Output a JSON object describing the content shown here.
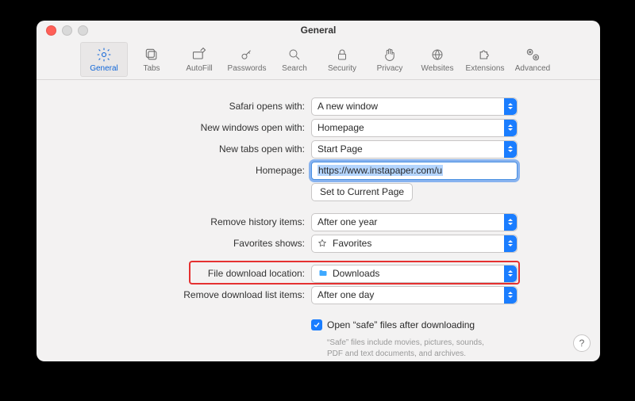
{
  "window": {
    "title": "General"
  },
  "tabs": [
    {
      "id": "general",
      "label": "General",
      "active": true
    },
    {
      "id": "tabs",
      "label": "Tabs",
      "active": false
    },
    {
      "id": "autofill",
      "label": "AutoFill",
      "active": false
    },
    {
      "id": "passwords",
      "label": "Passwords",
      "active": false
    },
    {
      "id": "search",
      "label": "Search",
      "active": false
    },
    {
      "id": "security",
      "label": "Security",
      "active": false
    },
    {
      "id": "privacy",
      "label": "Privacy",
      "active": false
    },
    {
      "id": "websites",
      "label": "Websites",
      "active": false
    },
    {
      "id": "extensions",
      "label": "Extensions",
      "active": false
    },
    {
      "id": "advanced",
      "label": "Advanced",
      "active": false
    }
  ],
  "form": {
    "opens_with": {
      "label": "Safari opens with:",
      "value": "A new window"
    },
    "new_windows": {
      "label": "New windows open with:",
      "value": "Homepage"
    },
    "new_tabs": {
      "label": "New tabs open with:",
      "value": "Start Page"
    },
    "homepage": {
      "label": "Homepage:",
      "value": "https://www.instapaper.com/u"
    },
    "set_current": {
      "label": "Set to Current Page"
    },
    "remove_history": {
      "label": "Remove history items:",
      "value": "After one year"
    },
    "favorites": {
      "label": "Favorites shows:",
      "value": "Favorites"
    },
    "download_loc": {
      "label": "File download location:",
      "value": "Downloads"
    },
    "remove_downloads": {
      "label": "Remove download list items:",
      "value": "After one day"
    },
    "open_safe": {
      "label": "Open “safe” files after downloading",
      "checked": true
    },
    "open_safe_hint1": "“Safe” files include movies, pictures, sounds,",
    "open_safe_hint2": "PDF and text documents, and archives."
  }
}
